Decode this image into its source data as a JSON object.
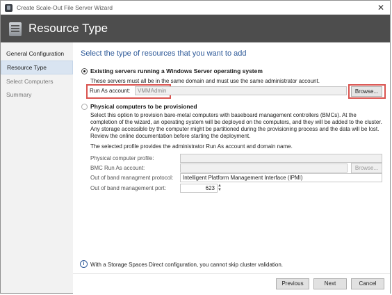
{
  "window": {
    "title": "Create Scale-Out File Server Wizard",
    "close_glyph": "✕"
  },
  "banner": {
    "title": "Resource Type"
  },
  "sidebar": {
    "items": [
      {
        "label": "General Configuration"
      },
      {
        "label": "Resource Type"
      },
      {
        "label": "Select Computers"
      },
      {
        "label": "Summary"
      }
    ]
  },
  "main": {
    "heading": "Select the type of resources that you want to add",
    "option_existing": {
      "label": "Existing servers running a Windows Server operating system",
      "description": "These servers must all be in the same domain and must use the same administrator account.",
      "run_as_label": "Run As account:",
      "run_as_value": "VMMAdmin",
      "browse_label": "Browse..."
    },
    "option_physical": {
      "label": "Physical computers to be provisioned",
      "description": "Select this option to provision bare-metal computers with baseboard management controllers (BMCs). At the completion of the wizard, an operating system will be deployed on the computers, and they will be added to the cluster. Any storage accessible by the computer might be partitioned during the provisioning process and the data will be lost. Review the online documentation before starting the deployment.",
      "profile_note": "The selected profile provides the administrator Run As account and domain name.",
      "profile_label": "Physical computer profile:",
      "bmc_label": "BMC Run As account:",
      "bmc_browse": "Browse...",
      "protocol_label": "Out of band managment protocol:",
      "protocol_value": "Intelligent Platform Management Interface (IPMI)",
      "port_label": "Out of band management port:",
      "port_value": "623"
    },
    "info_text": "With a Storage Spaces Direct configuration, you cannot skip cluster validation."
  },
  "footer": {
    "previous": "Previous",
    "next": "Next",
    "cancel": "Cancel"
  }
}
